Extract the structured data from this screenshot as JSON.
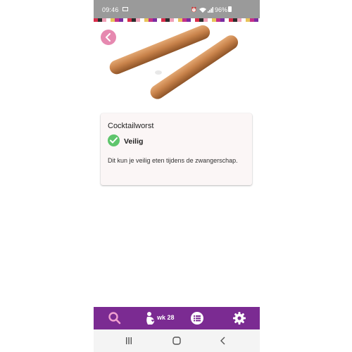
{
  "status_bar": {
    "time": "09:46",
    "battery": "96%",
    "icons": [
      "image-icon",
      "alarm-icon",
      "wifi-icon",
      "signal-icon",
      "battery-icon"
    ]
  },
  "header": {
    "back_icon": "chevron-left-icon",
    "accent_color": "#e689b0"
  },
  "food": {
    "name": "Cocktailworst",
    "status": "Veilig",
    "status_icon": "check-circle-icon",
    "status_color": "#5ec56c",
    "description": "Dit kun je veilig eten tijdens de zwangerschap."
  },
  "bottom_nav": {
    "background": "#7b2b92",
    "items": [
      {
        "icon": "search-icon",
        "color": "#f0a0d0"
      },
      {
        "icon": "pregnancy-icon",
        "label": "wk 28"
      },
      {
        "icon": "list-icon"
      },
      {
        "icon": "gear-icon"
      }
    ]
  },
  "system_nav": {
    "items": [
      "recent-apps-icon",
      "home-icon",
      "back-icon"
    ]
  }
}
